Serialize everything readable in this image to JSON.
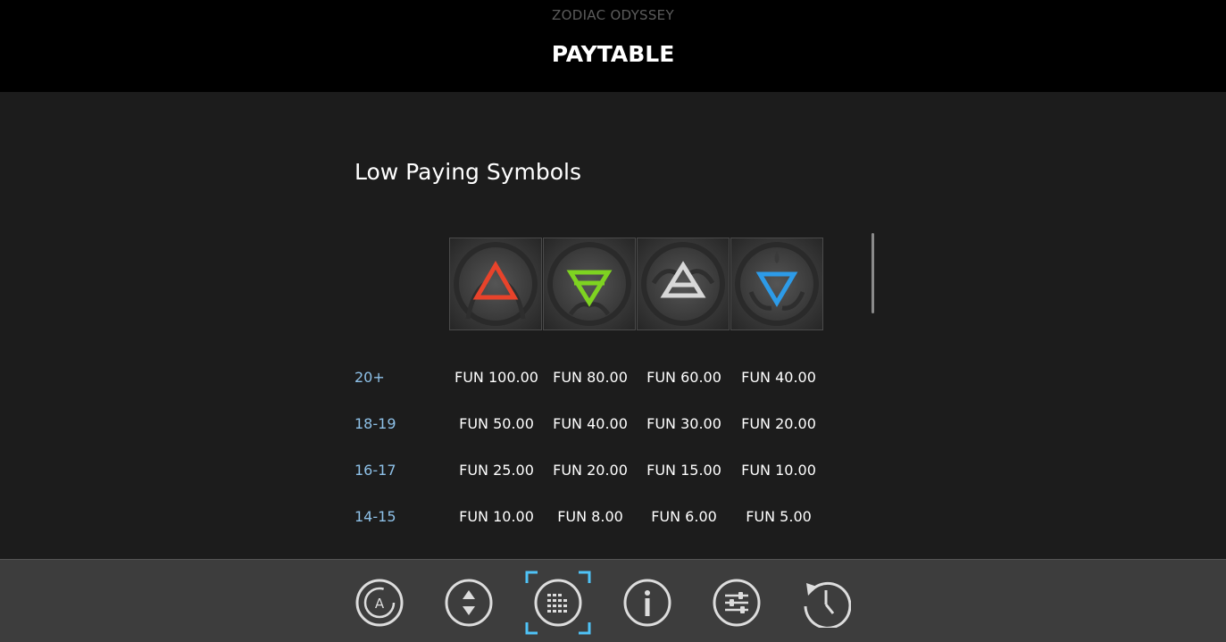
{
  "header": {
    "game_name": "ZODIAC ODYSSEY",
    "title": "PAYTABLE"
  },
  "section": {
    "title": "Low Paying Symbols"
  },
  "symbols": [
    {
      "icon": "red-triangle-fire-icon",
      "color": "#e8432b"
    },
    {
      "icon": "green-triangle-earth-icon",
      "color": "#7ed321"
    },
    {
      "icon": "white-triangle-air-icon",
      "color": "#d8d8d8"
    },
    {
      "icon": "blue-triangle-water-icon",
      "color": "#2d9be8"
    }
  ],
  "paytable": {
    "rows": [
      {
        "count": "20+",
        "values": [
          "FUN 100.00",
          "FUN 80.00",
          "FUN 60.00",
          "FUN 40.00"
        ]
      },
      {
        "count": "18-19",
        "values": [
          "FUN 50.00",
          "FUN 40.00",
          "FUN 30.00",
          "FUN 20.00"
        ]
      },
      {
        "count": "16-17",
        "values": [
          "FUN 25.00",
          "FUN 20.00",
          "FUN 15.00",
          "FUN 10.00"
        ]
      },
      {
        "count": "14-15",
        "values": [
          "FUN 10.00",
          "FUN 8.00",
          "FUN 6.00",
          "FUN 5.00"
        ]
      }
    ]
  },
  "toolbar": {
    "buttons": [
      {
        "icon": "autoplay-icon",
        "label": "A"
      },
      {
        "icon": "bet-adjust-icon"
      },
      {
        "icon": "paytable-icon",
        "selected": true
      },
      {
        "icon": "info-icon"
      },
      {
        "icon": "settings-sliders-icon"
      },
      {
        "icon": "history-icon"
      }
    ],
    "accent": "#4fc3f7"
  },
  "colors": {
    "header_bg": "#000000",
    "content_bg": "#1c1c1c",
    "toolbar_bg": "#3d3d3d",
    "count_text": "#8ec1e8"
  }
}
